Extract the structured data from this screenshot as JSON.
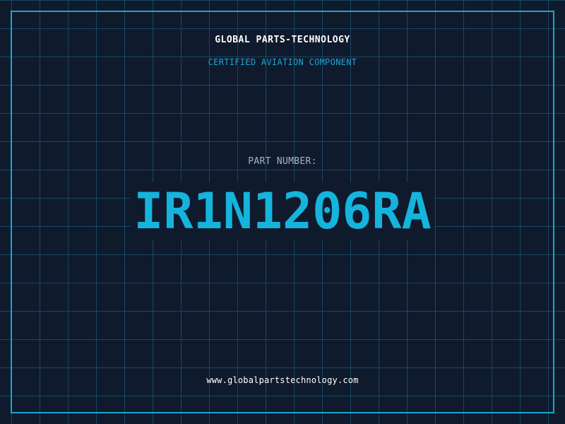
{
  "header": {
    "brand": "GLOBAL PARTS-TECHNOLOGY",
    "subtitle": "CERTIFIED AVIATION COMPONENT"
  },
  "part": {
    "label": "PART NUMBER:",
    "number": "IR1N1206RA"
  },
  "footer": {
    "url": "www.globalpartstechnology.com"
  },
  "colors": {
    "background": "#101a2d",
    "grid": "#1a6e8c",
    "frame": "#1aa6cf",
    "accent": "#15b4dc",
    "label": "#a8b4c4",
    "text": "#ffffff"
  }
}
